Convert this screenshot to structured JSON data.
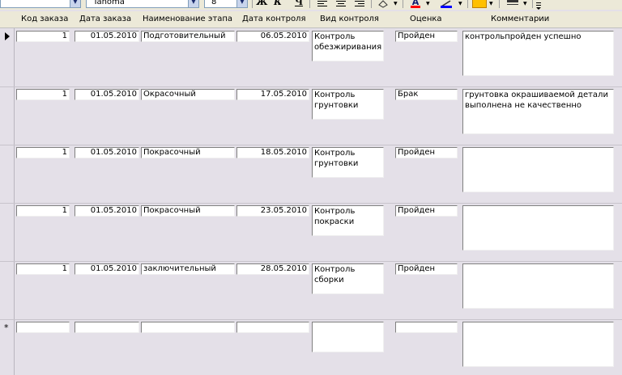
{
  "toolbar": {
    "font_name": "Tahoma",
    "font_size": "8",
    "bold_label": "Ж",
    "italic_label": "К",
    "underline_label": "Ч",
    "font_color_label": "A",
    "colors": {
      "font": "#ff0000",
      "line": "#0000ff",
      "fill": "#ffc000"
    }
  },
  "columns": {
    "order_code": "Код заказа",
    "order_date": "Дата заказа",
    "stage_name": "Наименование этапа",
    "control_date": "Дата контроля",
    "control_type": "Вид контроля",
    "grade": "Оценка",
    "comments": "Комментарии"
  },
  "rows": [
    {
      "order_code": "1",
      "order_date": "01.05.2010",
      "stage_name": "Подготовительный",
      "control_date": "06.05.2010",
      "control_type": "Контроль обезжиривания",
      "grade": "Пройден",
      "comments": "контрольпройден успешно"
    },
    {
      "order_code": "1",
      "order_date": "01.05.2010",
      "stage_name": "Окрасочный",
      "control_date": "17.05.2010",
      "control_type": "Контроль грунтовки",
      "grade": "Брак",
      "comments": "грунтовка окрашиваемой детали выполнена не качественно"
    },
    {
      "order_code": "1",
      "order_date": "01.05.2010",
      "stage_name": "Покрасочный",
      "control_date": "18.05.2010",
      "control_type": "Контроль грунтовки",
      "grade": "Пройден",
      "comments": ""
    },
    {
      "order_code": "1",
      "order_date": "01.05.2010",
      "stage_name": "Покрасочный",
      "control_date": "23.05.2010",
      "control_type": "Контроль покраски",
      "grade": "Пройден",
      "comments": ""
    },
    {
      "order_code": "1",
      "order_date": "01.05.2010",
      "stage_name": "заключительный",
      "control_date": "28.05.2010",
      "control_type": "Контроль сборки",
      "grade": "Пройден",
      "comments": ""
    }
  ],
  "new_record_marker": "*",
  "current_record_marker": "►"
}
